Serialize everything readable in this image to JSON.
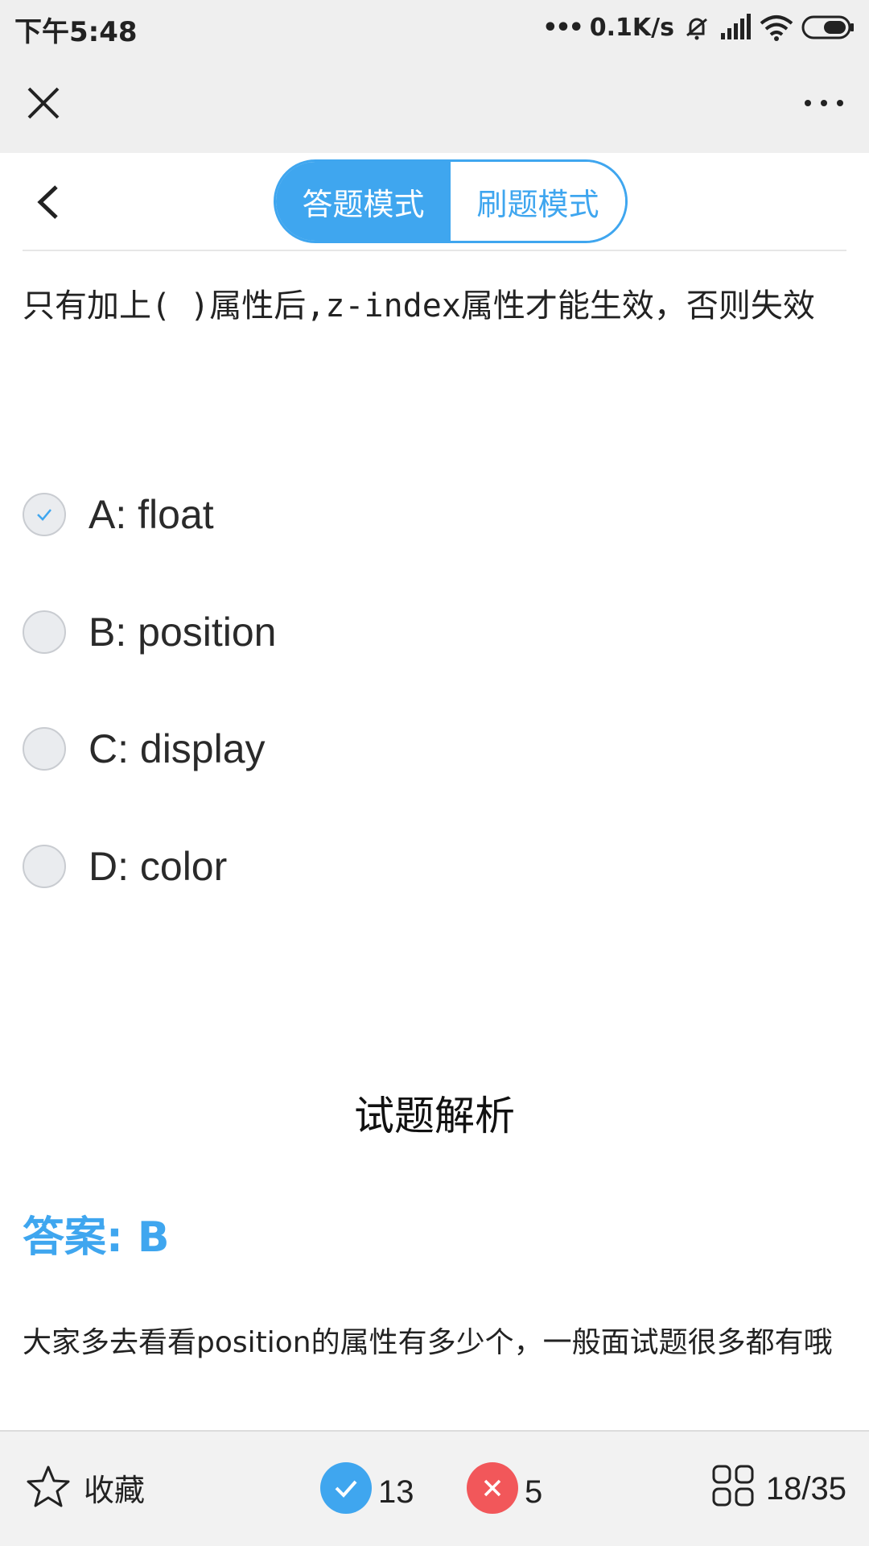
{
  "status_bar": {
    "time": "下午5:48",
    "net_speed": "0.1K/s",
    "dots": "•••"
  },
  "header": {
    "modes": [
      {
        "label": "答题模式",
        "active": true
      },
      {
        "label": "刷题模式",
        "active": false
      }
    ]
  },
  "question": {
    "text": "只有加上(   )属性后,z-index属性才能生效，否则失效"
  },
  "options": [
    {
      "label": "A: float",
      "checked": true
    },
    {
      "label": "B: position",
      "checked": false
    },
    {
      "label": "C: display",
      "checked": false
    },
    {
      "label": "D: color",
      "checked": false
    }
  ],
  "analysis": {
    "title": "试题解析",
    "answer": "答案: B",
    "explanation": "大家多去看看position的属性有多少个，一般面试题很多都有哦"
  },
  "bottom_bar": {
    "favorite_label": "收藏",
    "correct_count": "13",
    "wrong_count": "5",
    "progress": "18/35"
  },
  "colors": {
    "accent": "#3fa6ef",
    "correct": "#3fa6ef",
    "wrong": "#f2575a"
  }
}
